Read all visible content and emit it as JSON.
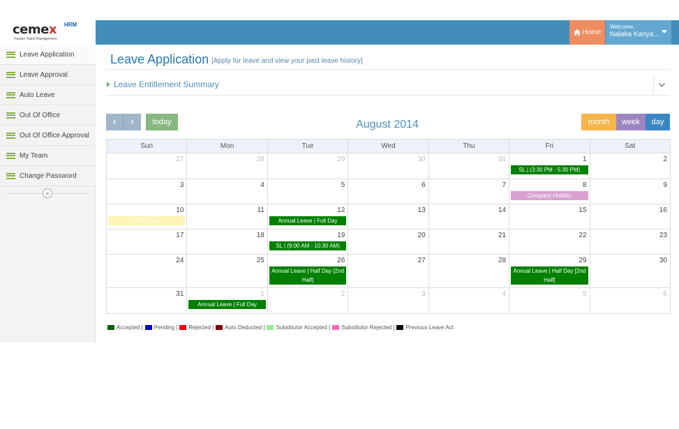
{
  "brand": {
    "name_pre": "ceme",
    "name_x": "x",
    "hrm": "HRM",
    "tagline": "Human Talent Management"
  },
  "sidebar": {
    "items": [
      {
        "label": "Leave Application"
      },
      {
        "label": "Leave Approval"
      },
      {
        "label": "Auto Leave"
      },
      {
        "label": "Out Of Office"
      },
      {
        "label": "Out Of Office Approval"
      },
      {
        "label": "My Team"
      },
      {
        "label": "Change Password"
      }
    ],
    "collapse_glyph": "«"
  },
  "header": {
    "home_label": "Home",
    "welcome_label": "Welcome,",
    "user_name": "Nalaka Kariya..."
  },
  "page": {
    "title": "Leave Application",
    "subtitle": "[Apply for leave and view your past leave history]",
    "accordion_title": "Leave Entitlement Summary"
  },
  "calendar": {
    "title": "August 2014",
    "today_label": "today",
    "view_month": "month",
    "view_week": "week",
    "view_day": "day",
    "prev_glyph": "‹",
    "next_glyph": "›",
    "weekdays": [
      "Sun",
      "Mon",
      "Tue",
      "Wed",
      "Thu",
      "Fri",
      "Sat"
    ],
    "weeks": [
      [
        "27",
        "28",
        "29",
        "30",
        "31",
        "1",
        "2"
      ],
      [
        "3",
        "4",
        "5",
        "6",
        "7",
        "8",
        "9"
      ],
      [
        "10",
        "11",
        "12",
        "13",
        "14",
        "15",
        "16"
      ],
      [
        "17",
        "18",
        "19",
        "20",
        "21",
        "22",
        "23"
      ],
      [
        "24",
        "25",
        "26",
        "27",
        "28",
        "29",
        "30"
      ],
      [
        "31",
        "1",
        "2",
        "3",
        "4",
        "5",
        "6"
      ]
    ],
    "events": {
      "e1": "SL | (3:30 PM - 5:30 PM)",
      "e2": "Company Holiday",
      "e3": "Poya Day",
      "e4": "Annual Leave | Full Day",
      "e5": "SL | (9:00 AM - 10:30 AM)",
      "e6": "Annual Leave | Half Day [2nd Half]",
      "e7": "Annual Leave | Half Day [2nd Half]",
      "e8": "Annual Leave | Full Day"
    }
  },
  "legend": [
    {
      "label": "Accepted |",
      "color": "#006400"
    },
    {
      "label": "Pending |",
      "color": "#0000cc"
    },
    {
      "label": "Rejected |",
      "color": "#ff0000"
    },
    {
      "label": "Auto Deducted |",
      "color": "#800000"
    },
    {
      "label": "Substitutor Accepted |",
      "color": "#90ee90"
    },
    {
      "label": "Substitutor Rejected |",
      "color": "#ff69b4"
    },
    {
      "label": "Previous Leave Act",
      "color": "#000000"
    }
  ]
}
